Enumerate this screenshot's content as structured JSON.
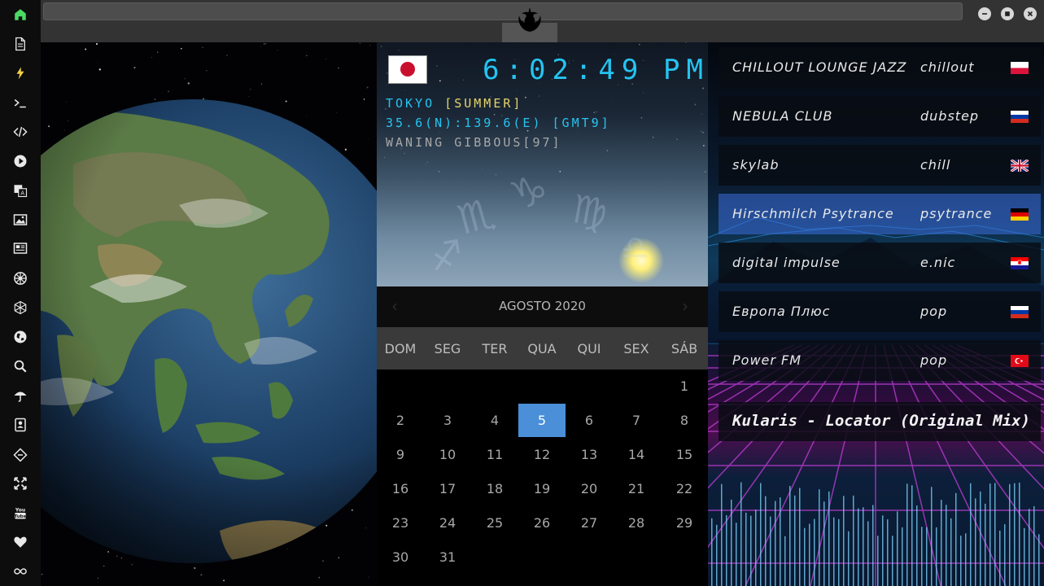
{
  "sidebar": {
    "items": [
      {
        "icon": "home-icon"
      },
      {
        "icon": "document-icon"
      },
      {
        "icon": "lightning-icon"
      },
      {
        "icon": "terminal-icon"
      },
      {
        "icon": "code-icon"
      },
      {
        "icon": "play-icon"
      },
      {
        "icon": "translate-icon"
      },
      {
        "icon": "image-icon"
      },
      {
        "icon": "news-icon"
      },
      {
        "icon": "empire-icon"
      },
      {
        "icon": "hexagon-icon"
      },
      {
        "icon": "globe-icon"
      },
      {
        "icon": "search-icon"
      },
      {
        "icon": "umbrella-icon"
      },
      {
        "icon": "contacts-icon"
      },
      {
        "icon": "link-icon"
      },
      {
        "icon": "expand-icon"
      },
      {
        "icon": "youtube-icon"
      },
      {
        "icon": "heart-icon"
      },
      {
        "icon": "infinity-icon"
      }
    ],
    "youtube_label": "You\nTube"
  },
  "window": {
    "logo": "rebel-alliance-icon",
    "controls": [
      "minimize-icon",
      "maximize-icon",
      "close-icon"
    ]
  },
  "clock": {
    "time": "6:02:49",
    "ampm": "PM",
    "flag": "japan-flag-icon",
    "city_line": "TOKYO",
    "season": "[SUMMER]",
    "coords_line": "35.6(N):139.6(E) [GMT9]",
    "moon_line": "WANING GIBBOUS[97]",
    "zodiac_glyphs": [
      "♐",
      "♏",
      "♑",
      "♍",
      "♎"
    ]
  },
  "calendar": {
    "month_label": "AGOSTO 2020",
    "prev": "‹",
    "next": "›",
    "weekdays": [
      "DOM",
      "SEG",
      "TER",
      "QUA",
      "QUI",
      "SEX",
      "SÁB"
    ],
    "days": [
      "1",
      "2",
      "3",
      "4",
      "5",
      "6",
      "7",
      "8",
      "9",
      "10",
      "11",
      "12",
      "13",
      "14",
      "15",
      "16",
      "17",
      "18",
      "19",
      "20",
      "21",
      "22",
      "23",
      "24",
      "25",
      "26",
      "27",
      "28",
      "29",
      "30",
      "31"
    ],
    "first_weekday": 6,
    "today": "5"
  },
  "radio": {
    "stations": [
      {
        "name": "CHILLOUT LOUNGE JAZZ",
        "genre": "chillout",
        "flag": "poland-flag-icon"
      },
      {
        "name": "NEBULA CLUB",
        "genre": "dubstep",
        "flag": "russia-flag-icon"
      },
      {
        "name": "skylab",
        "genre": "chill",
        "flag": "uk-flag-icon"
      },
      {
        "name": "Hirschmilch Psytrance",
        "genre": "psytrance",
        "flag": "germany-flag-icon"
      },
      {
        "name": "digital impulse",
        "genre": "e.nic",
        "flag": "croatia-flag-icon"
      },
      {
        "name": "Европа Плюс",
        "genre": "pop",
        "flag": "russia-flag-icon"
      },
      {
        "name": "Power FM",
        "genre": "pop",
        "flag": "turkey-flag-icon"
      }
    ],
    "active_index": 3,
    "now_playing": "Kularis - Locator (Original Mix)"
  }
}
